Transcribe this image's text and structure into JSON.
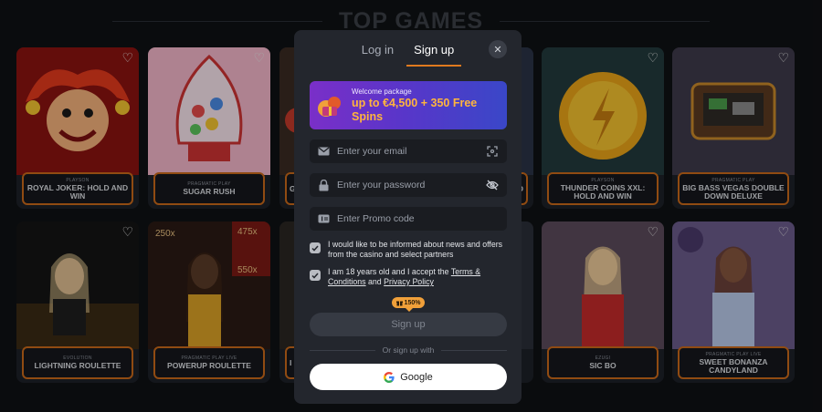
{
  "section_title": "TOP GAMES",
  "games": [
    {
      "provider": "PLAYSON",
      "name": "ROYAL JOKER: HOLD AND WIN"
    },
    {
      "provider": "PRAGMATIC PLAY",
      "name": "SUGAR RUSH"
    },
    {
      "provider": "",
      "name": "GO"
    },
    {
      "provider": "",
      "name": "D"
    },
    {
      "provider": "PLAYSON",
      "name": "THUNDER COINS XXL: HOLD AND WIN"
    },
    {
      "provider": "PRAGMATIC PLAY",
      "name": "BIG BASS VEGAS DOUBLE DOWN DELUXE"
    },
    {
      "provider": "EVOLUTION",
      "name": "LIGHTNING ROULETTE"
    },
    {
      "provider": "PRAGMATIC PLAY LIVE",
      "name": "POWERUP ROULETTE"
    },
    {
      "provider": "",
      "name": "I"
    },
    {
      "provider": "",
      "name": ""
    },
    {
      "provider": "EZUGI",
      "name": "SIC BO"
    },
    {
      "provider": "PRAGMATIC PLAY LIVE",
      "name": "SWEET BONANZA CANDYLAND"
    }
  ],
  "modal": {
    "tabs": [
      "Log in",
      "Sign up"
    ],
    "active_tab": "Sign up",
    "close_icon": "close-icon",
    "promo": {
      "label": "Welcome package",
      "headline": "up to €4,500 + 350 Free Spins"
    },
    "email_placeholder": "Enter your email",
    "password_placeholder": "Enter your password",
    "promo_placeholder": "Enter Promo code",
    "news_consent": "I would like to be informed about news and offers from the casino and select partners",
    "age_consent_prefix": "I am 18 years old and I accept the ",
    "terms_link": "Terms & Conditions",
    "age_consent_and": " and ",
    "privacy_link": "Privacy Policy",
    "boost_badge": "150%",
    "signup_button": "Sign up",
    "or_text": "Or sign up with",
    "google_button": "Google"
  },
  "colors": {
    "accent": "#e07a1f",
    "promo_text": "#ffb53d",
    "modal_bg": "#23262d",
    "page_bg": "#0f1114"
  }
}
